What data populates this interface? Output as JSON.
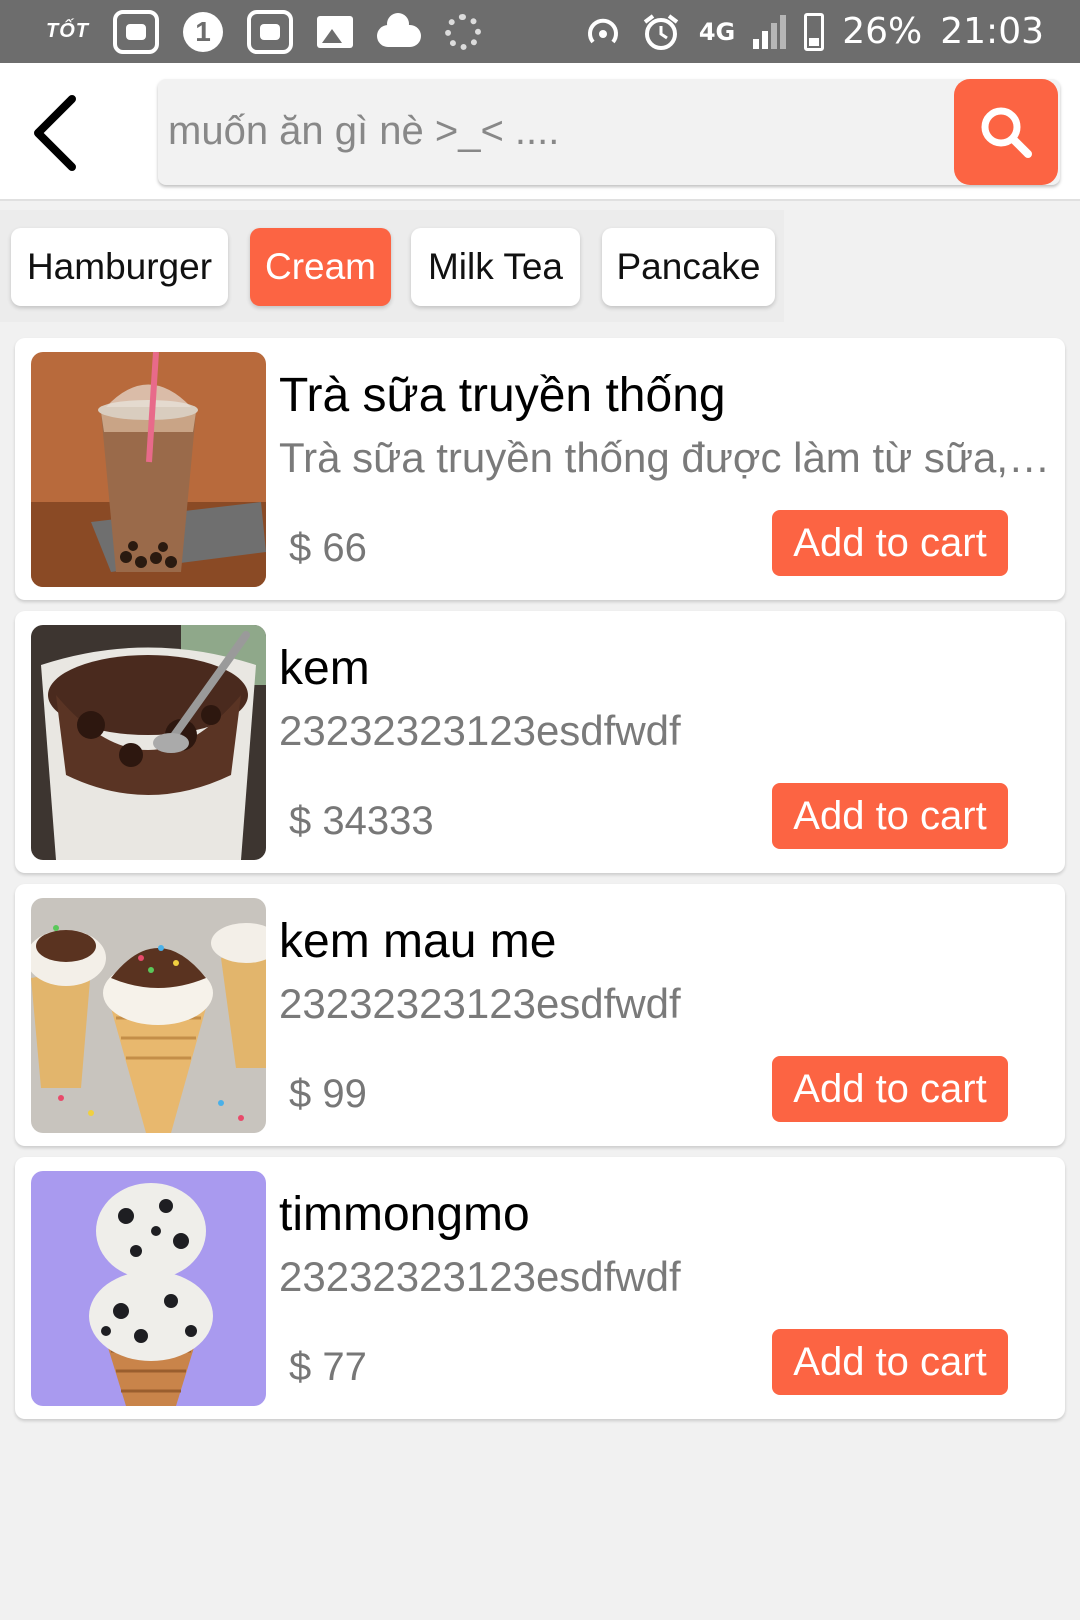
{
  "status_bar": {
    "carrier_brand": "TỐT",
    "notification_count": "1",
    "network": "4G",
    "battery": "26%",
    "time": "21:03",
    "icons": [
      "robot-icon",
      "one-badge-icon",
      "robot-icon",
      "image-icon",
      "cloud-icon",
      "loading-icon",
      "hotspot-icon",
      "alarm-icon",
      "signal-icon",
      "battery-icon"
    ]
  },
  "header": {
    "search_placeholder": "muốn ăn gì nè >_< ....",
    "back_icon": "chevron-left-icon",
    "search_icon": "search-icon",
    "accent_color": "#fc6443"
  },
  "categories": [
    {
      "label": "Hamburger",
      "active": false
    },
    {
      "label": "Cream",
      "active": true
    },
    {
      "label": "Milk Tea",
      "active": false
    },
    {
      "label": "Pancake",
      "active": false
    }
  ],
  "products": [
    {
      "name": "Trà sữa truyền thống",
      "description": "Trà sữa truyền thống được làm từ sữa, r...",
      "price": "$ 66",
      "button": "Add to cart"
    },
    {
      "name": "kem",
      "description": "2323232312​3esdfwdf",
      "price": "$ 34333",
      "button": "Add to cart"
    },
    {
      "name": "kem mau me",
      "description": "2323232312​3esdfwdf",
      "price": "$ 99",
      "button": "Add to cart"
    },
    {
      "name": "timmongmo",
      "description": "2323232312​3esdfwdf",
      "price": "$ 77",
      "button": "Add to cart"
    }
  ]
}
